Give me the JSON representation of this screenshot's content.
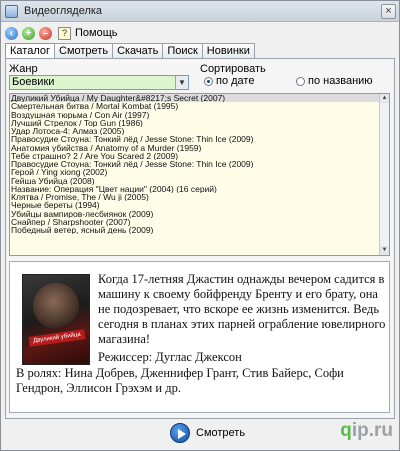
{
  "window": {
    "title": "Видеогляделка"
  },
  "toolbar": {
    "help_label": "Помощь"
  },
  "tabs": [
    {
      "label": "Каталог"
    },
    {
      "label": "Смотреть"
    },
    {
      "label": "Скачать"
    },
    {
      "label": "Поиск"
    },
    {
      "label": "Новинки"
    }
  ],
  "genre": {
    "label": "Жанр",
    "value": "Боевики"
  },
  "sort": {
    "label": "Сортировать",
    "options": [
      {
        "label": "по дате",
        "selected": true
      },
      {
        "label": "по названию",
        "selected": false
      }
    ]
  },
  "movies": [
    "Двуликий Убийца / My Daughter&#8217;s Secret (2007)",
    "Смертельная битва / Mortal Kombat (1995)",
    "Воздушная тюрьма / Con Air (1997)",
    "Лучший Стрелок / Top Gun (1986)",
    "Удар Лотоса-4: Алмаз (2005)",
    "Правосудие Стоуна: Тонкий лёд / Jesse Stone: Thin Ice (2009)",
    "Анатомия убийства / Anatomy of a Murder (1959)",
    "Тебе страшно? 2 / Are You Scared 2 (2009)",
    "Правосудие Стоуна: Тонкий лёд / Jesse Stone: Thin Ice (2009)",
    "Герой / Ying xiong (2002)",
    "Гейша Убийца (2008)",
    "Название: Операция \"Цвет нации\" (2004) (16 серий)",
    "Клятва / Promise, The / Wu ji (2005)",
    "Черные береты (1994)",
    "Убийцы вампиров-лесбиянок (2009)",
    "Снайпер / Sharpshooter (2007)",
    "Победный ветер, ясный день (2009)"
  ],
  "details": {
    "poster_text": "Двуликий убийца",
    "description": "Когда 17-летняя Джастин однажды вечером садится в машину к своему бойфренду Бренту и его брату, она не подозревает, что вскоре ее жизнь изменится. Ведь сегодня в планах этих парней ограбление ювелирного магазина!",
    "director": "Режиссер: Дуглас Джексон",
    "cast": "В ролях: Нина Добрев, Дженнифер Грант, Стив Байерс, Софи Гендрон, Эллисон Грэхэм и др."
  },
  "watch": {
    "label": "Смотреть"
  },
  "watermark": {
    "q": "q",
    "rest": "ip.ru"
  }
}
